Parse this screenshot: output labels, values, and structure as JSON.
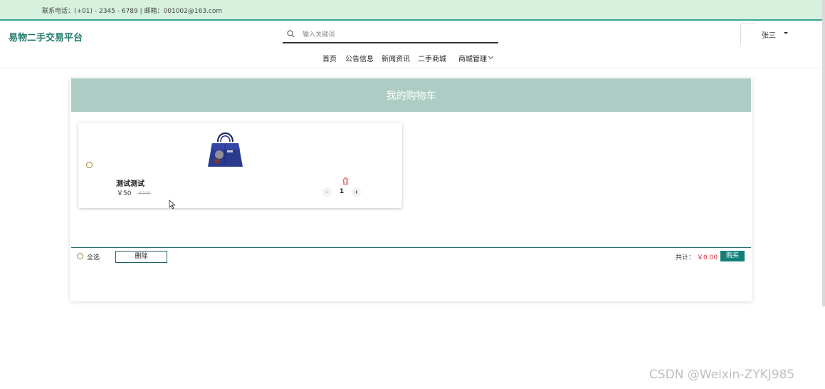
{
  "topbar": {
    "contact": "联系电话：(+01) - 2345 - 6789 | 邮箱：001002@163.com"
  },
  "header": {
    "logo": "易物二手交易平台",
    "search_placeholder": "输入关键词",
    "username": "张三"
  },
  "nav": {
    "items": [
      {
        "label": "首页"
      },
      {
        "label": "公告信息"
      },
      {
        "label": "新闻资讯"
      },
      {
        "label": "二手商城"
      },
      {
        "label": "商城管理"
      }
    ]
  },
  "cart": {
    "title": "我的购物车",
    "items": [
      {
        "name": "测试测试",
        "price": "￥50",
        "original_price": "￥100",
        "quantity": "1",
        "minus": "-",
        "plus": "+"
      }
    ],
    "select_all": "全选",
    "delete_label": "删除",
    "total_label": "共计：",
    "total_value": "￥0.00",
    "buy_label": "购买"
  },
  "watermark": "CSDN @Weixin-ZYKJ985",
  "colors": {
    "accent": "#1f7a6b",
    "header_bg": "#adcdc4",
    "topbar_bg": "#d6f2df",
    "price_red": "#d2333b",
    "buy_button": "#138078"
  },
  "icons": {
    "search": "search-icon",
    "trash": "trash-icon",
    "user_caret": "caret-down-icon",
    "nav_chevron": "chevron-down-icon"
  }
}
